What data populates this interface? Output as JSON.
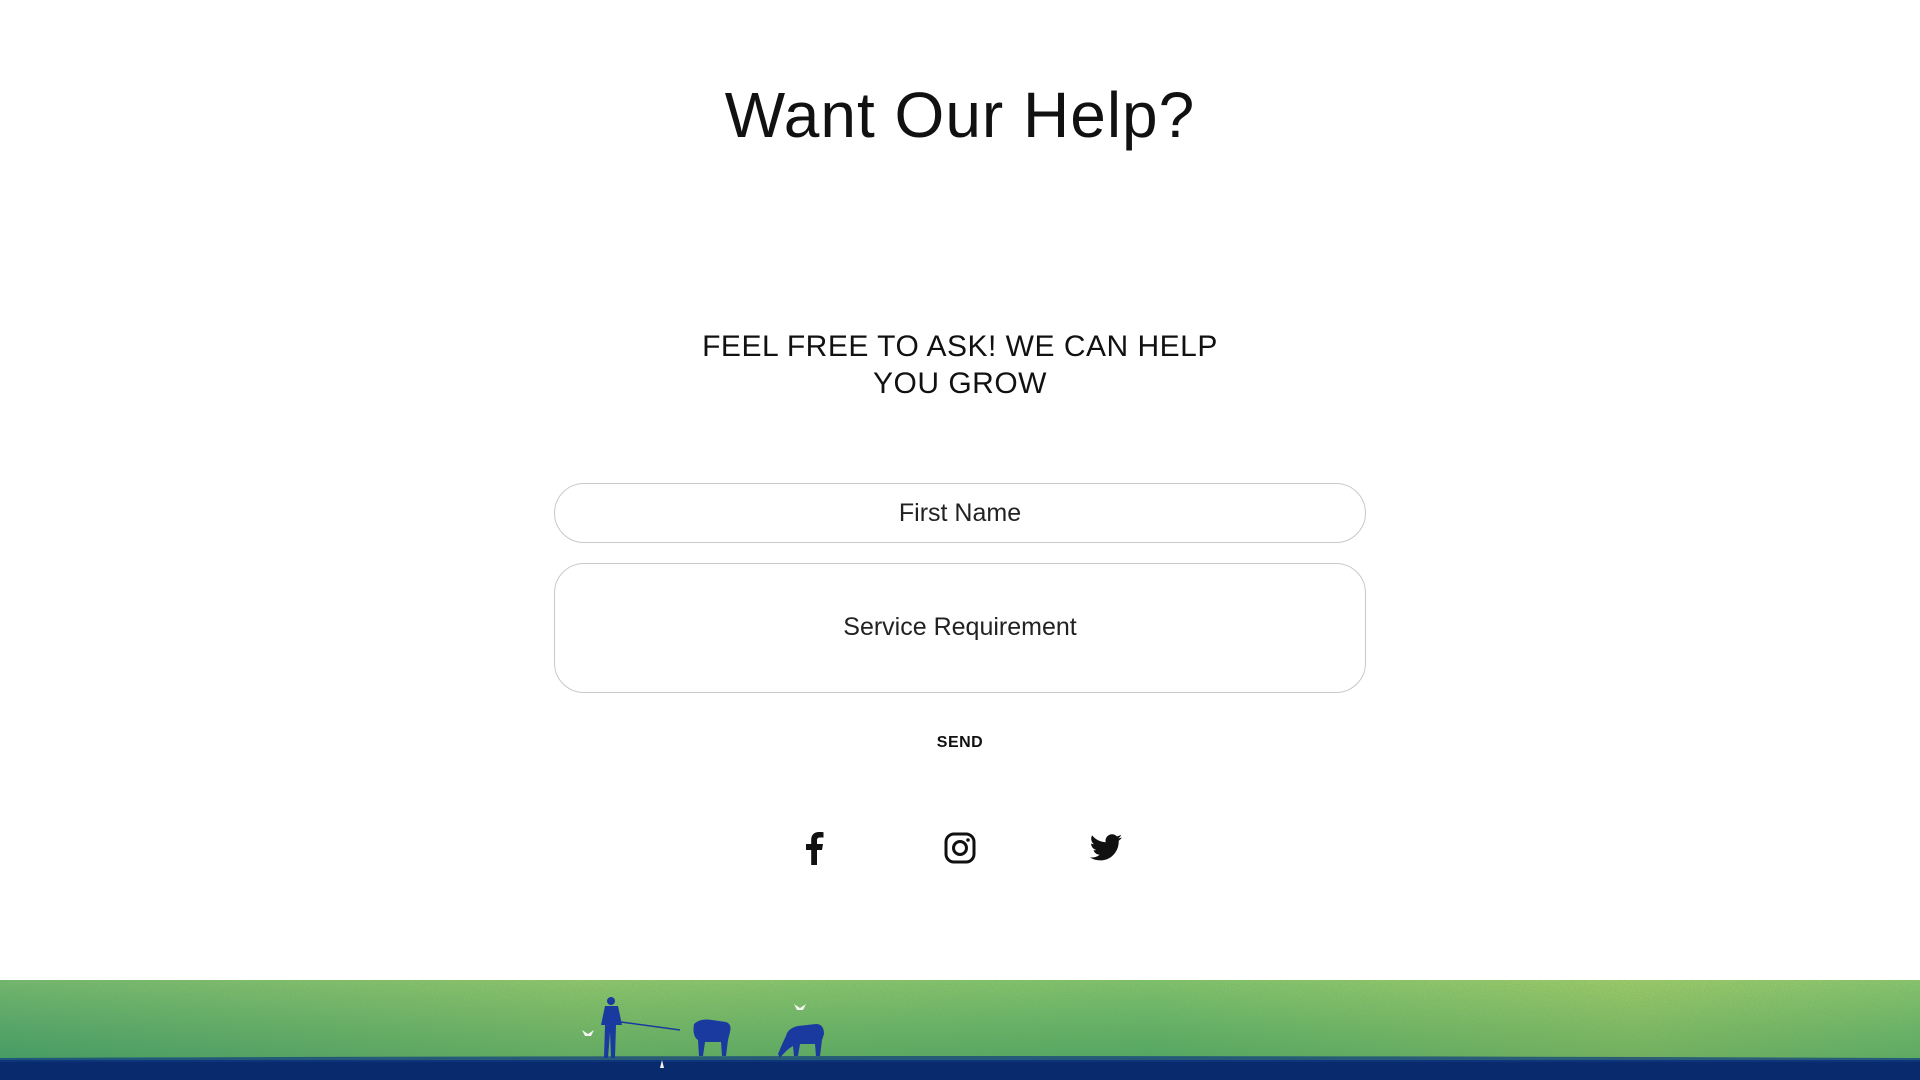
{
  "heading": {
    "title": "Want Our Help?",
    "subtitle_line1": "FEEL FREE TO ASK! WE CAN HELP",
    "subtitle_line2": "YOU GROW"
  },
  "form": {
    "first_name_placeholder": "First Name",
    "first_name_value": "",
    "service_placeholder": "Service Requirement",
    "service_value": "",
    "send_label": "SEND"
  },
  "socials": [
    {
      "name": "facebook",
      "icon": "facebook-icon"
    },
    {
      "name": "instagram",
      "icon": "instagram-icon"
    },
    {
      "name": "twitter",
      "icon": "twitter-icon"
    }
  ],
  "banner": {
    "colors": {
      "grass_light": "#b8d65a",
      "grass_mid": "#5cb85c",
      "grass_dark": "#2e8b57",
      "shadow_band": "#0a2a6e",
      "silhouette": "#1a3aa0"
    },
    "scene": "meadow-illustration"
  },
  "colors": {
    "text": "#111111",
    "field_border": "#c9c9c9",
    "background": "#ffffff"
  }
}
